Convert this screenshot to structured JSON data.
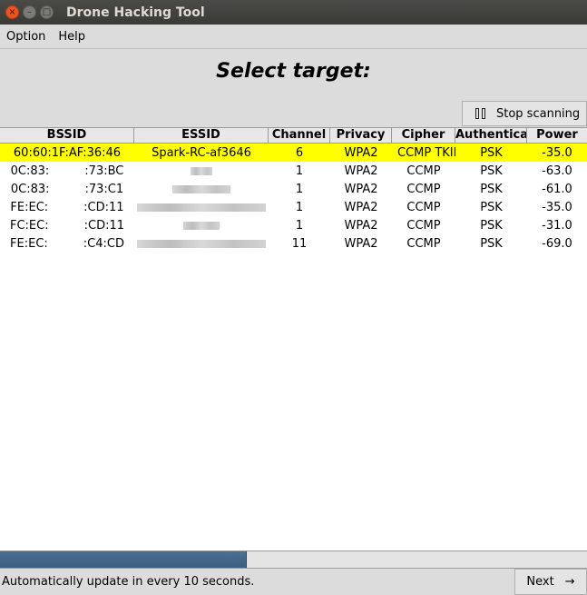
{
  "window": {
    "title": "Drone Hacking Tool",
    "close_glyph": "×",
    "min_glyph": "–",
    "max_glyph": "□"
  },
  "menu": {
    "items": [
      "Option",
      "Help"
    ]
  },
  "heading": "Select target:",
  "stop_button": {
    "label": "Stop scanning",
    "icon": "pause-icon"
  },
  "table": {
    "columns": [
      "BSSID",
      "ESSID",
      "Channel",
      "Privacy",
      "Cipher",
      "Authenticat",
      "Power"
    ],
    "rows": [
      {
        "bssid": "60:60:1F:AF:36:46",
        "essid": "Spark-RC-af3646",
        "channel": "6",
        "privacy": "WPA2",
        "cipher": "CCMP TKIP",
        "auth": "PSK",
        "power": "-35.0",
        "selected": true
      },
      {
        "bssid": "0C:83:   :73:BC",
        "essid": "",
        "channel": "1",
        "privacy": "WPA2",
        "cipher": "CCMP",
        "auth": "PSK",
        "power": "-63.0"
      },
      {
        "bssid": "0C:83:   :73:C1",
        "essid": "",
        "channel": "1",
        "privacy": "WPA2",
        "cipher": "CCMP",
        "auth": "PSK",
        "power": "-61.0"
      },
      {
        "bssid": "FE:EC:   :CD:11",
        "essid": "",
        "channel": "1",
        "privacy": "WPA2",
        "cipher": "CCMP",
        "auth": "PSK",
        "power": "-35.0"
      },
      {
        "bssid": "FC:EC:   :CD:11",
        "essid": "",
        "channel": "1",
        "privacy": "WPA2",
        "cipher": "CCMP",
        "auth": "PSK",
        "power": "-31.0"
      },
      {
        "bssid": "FE:EC:   :C4:CD",
        "essid": "",
        "channel": "11",
        "privacy": "WPA2",
        "cipher": "CCMP",
        "auth": "PSK",
        "power": "-69.0"
      }
    ]
  },
  "progress": {
    "fraction": 0.42
  },
  "status": {
    "text": "Automatically update in every 10 seconds."
  },
  "next_button": {
    "label": "Next",
    "arrow": "→"
  },
  "colors": {
    "selected_row": "#ffff00",
    "progress": "#3d5f80",
    "titlebar": "#3c3b37"
  }
}
